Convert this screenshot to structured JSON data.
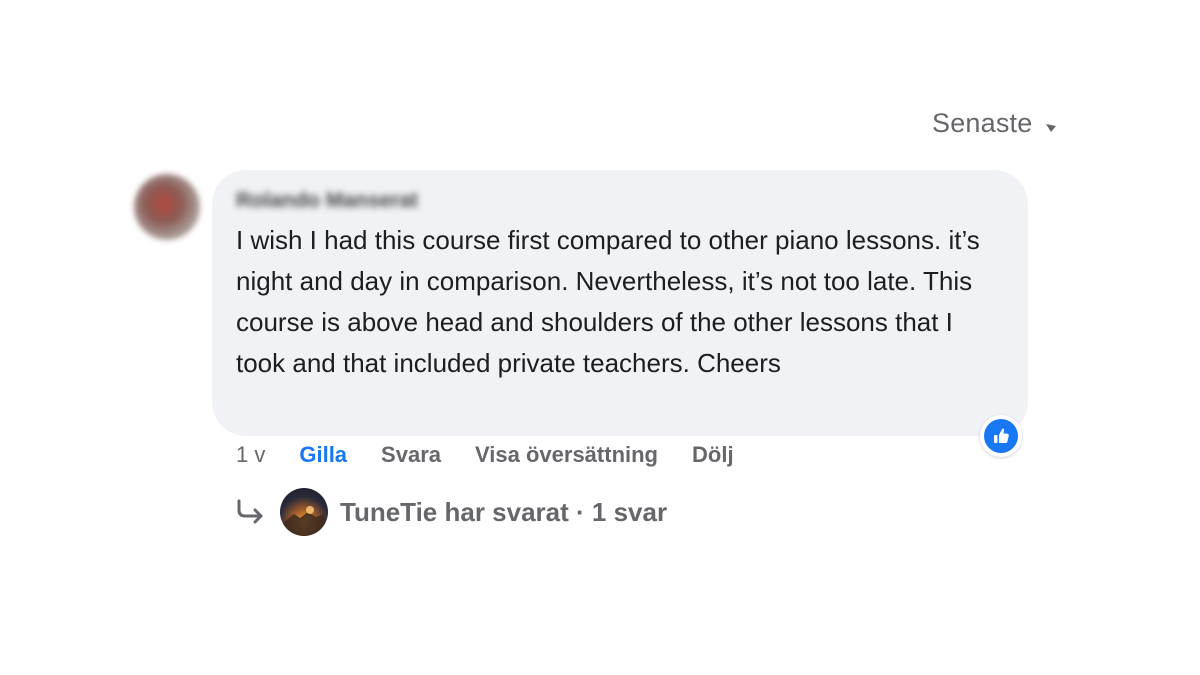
{
  "sort": {
    "label": "Senaste",
    "icon": "chevron-down-icon"
  },
  "comment": {
    "author": "Rolando Manserat",
    "text": "I wish I had this course first compared to other piano lessons. it’s night and day in comparison. Nevertheless, it’s not too late. This course is above head and shoulders of the other lessons that I took and that included private teachers. Cheers",
    "reaction_icon": "like-icon",
    "time": "1 v",
    "actions": {
      "like": "Gilla",
      "reply": "Svara",
      "translate": "Visa översättning",
      "hide": "Dölj"
    }
  },
  "replies": {
    "text": "TuneTie har svarat · 1 svar",
    "icon": "reply-arrow-icon"
  },
  "colors": {
    "accent": "#1877f2",
    "bubble": "#f0f2f5",
    "muted": "#65676b"
  }
}
